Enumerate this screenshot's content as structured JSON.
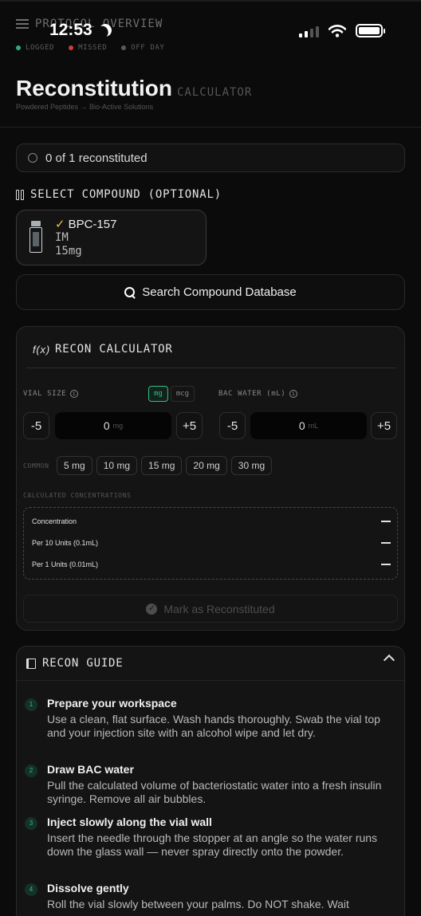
{
  "status_bar": {
    "time": "12:53"
  },
  "protocol": {
    "label": "PROTOCOL OVERVIEW"
  },
  "legend": [
    {
      "label": "LOGGED",
      "color": "#2fae7a"
    },
    {
      "label": "MISSED",
      "color": "#d13b3b"
    },
    {
      "label": "OFF DAY",
      "color": "#5a5a5a"
    }
  ],
  "header": {
    "title": "Reconstitution",
    "title_suffix": "CALCULATOR",
    "subtitle": "Powdered Peptides → Bio-Active Solutions"
  },
  "progress": {
    "text": "0 of 1 reconstituted"
  },
  "select_compound": {
    "heading": "SELECT COMPOUND (OPTIONAL)",
    "selected": {
      "check": "✓",
      "name": "BPC-157",
      "route": "IM",
      "amount": "15mg"
    }
  },
  "search": {
    "label": "Search Compound Database"
  },
  "calculator": {
    "heading": "RECON CALCULATOR",
    "fx": "f(x)",
    "vial_size_label": "VIAL SIZE",
    "units": [
      "mg",
      "mcg"
    ],
    "bac_water_label": "BAC WATER (mL)",
    "vial": {
      "minus": "-5",
      "value": "0",
      "unit": "mg",
      "plus": "+5"
    },
    "water": {
      "minus": "-5",
      "value": "0",
      "unit": "mL",
      "plus": "+5"
    },
    "common_label": "COMMON",
    "common_options": [
      "5 mg",
      "10 mg",
      "15 mg",
      "20 mg",
      "30 mg"
    ],
    "concentrations_label": "CALCULATED CONCENTRATIONS",
    "concentrations": [
      {
        "label": "Concentration"
      },
      {
        "label": "Per 10 Units (0.1mL)"
      },
      {
        "label": "Per 1 Units (0.01mL)"
      }
    ],
    "mark_button": "Mark as Reconstituted"
  },
  "guide": {
    "heading": "RECON GUIDE",
    "steps": [
      {
        "num": "1",
        "title": "Prepare your workspace",
        "text": "Use a clean, flat surface. Wash hands thoroughly. Swab the vial top and your injection site with an alcohol wipe and let dry."
      },
      {
        "num": "2",
        "title": "Draw BAC water",
        "text": "Pull the calculated volume of bacteriostatic water into a fresh insulin syringe. Remove all air bubbles."
      },
      {
        "num": "3",
        "title": "Inject slowly along the vial wall",
        "text": "Insert the needle through the stopper at an angle so the water runs down the glass wall — never spray directly onto the powder."
      },
      {
        "num": "4",
        "title": "Dissolve gently",
        "text": "Roll the vial slowly between your palms. Do NOT shake. Wait"
      }
    ]
  }
}
